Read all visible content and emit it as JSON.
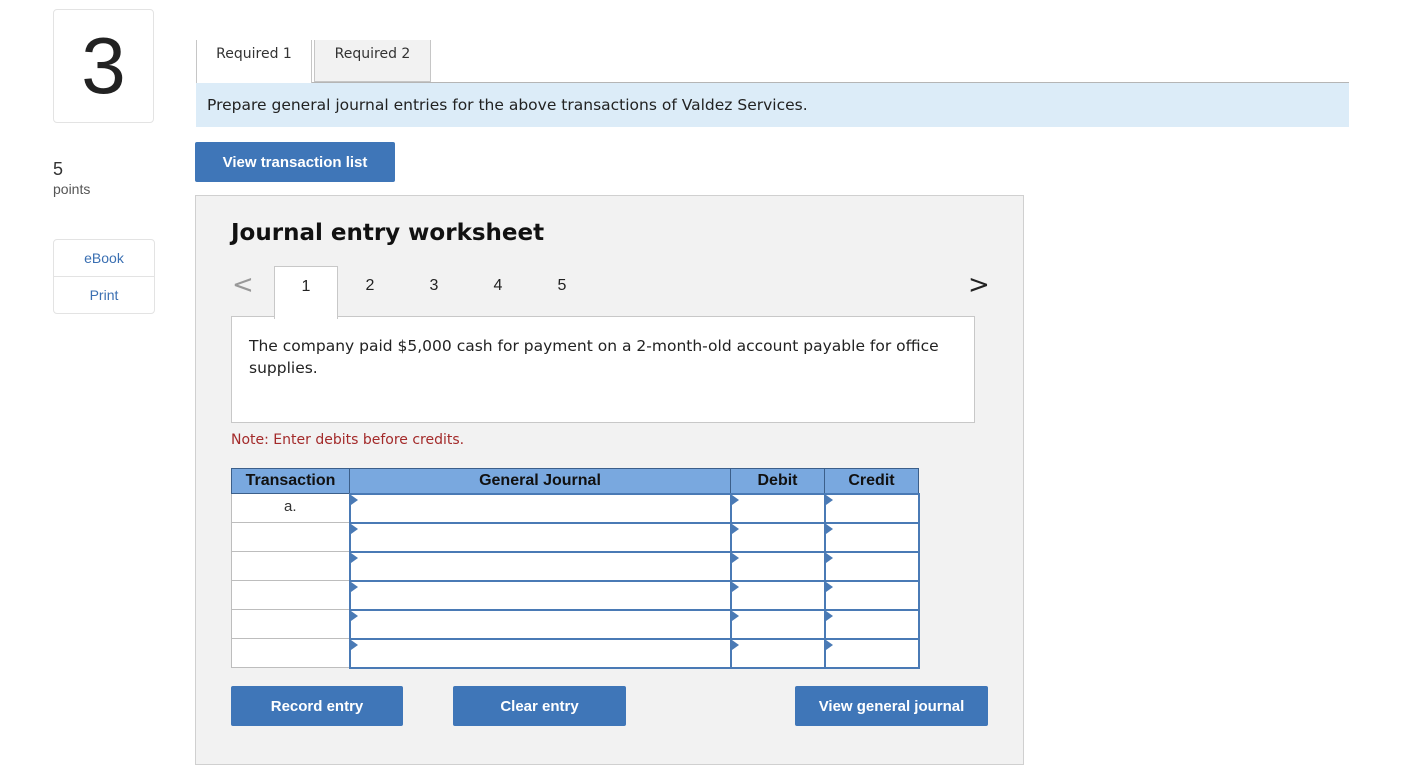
{
  "question": {
    "number": "3",
    "points_value": "5",
    "points_label": "points"
  },
  "side_links": {
    "ebook": "eBook",
    "print": "Print"
  },
  "tabs": {
    "required1": "Required 1",
    "required2": "Required 2"
  },
  "instruction": "Prepare general journal entries for the above transactions of Valdez Services.",
  "buttons": {
    "view_transaction_list": "View transaction list",
    "record_entry": "Record entry",
    "clear_entry": "Clear entry",
    "view_general_journal": "View general journal"
  },
  "worksheet": {
    "title": "Journal entry worksheet",
    "prev_arrow": "<",
    "next_arrow": ">",
    "pages": [
      "1",
      "2",
      "3",
      "4",
      "5"
    ],
    "active_page": "1",
    "description": "The company paid $5,000 cash for payment on a 2-month-old account payable for office supplies.",
    "note": "Note: Enter debits before credits."
  },
  "journal_table": {
    "headers": {
      "transaction": "Transaction",
      "general_journal": "General Journal",
      "debit": "Debit",
      "credit": "Credit"
    },
    "rows": [
      {
        "transaction": "a.",
        "account": "",
        "debit": "",
        "credit": ""
      },
      {
        "transaction": "",
        "account": "",
        "debit": "",
        "credit": ""
      },
      {
        "transaction": "",
        "account": "",
        "debit": "",
        "credit": ""
      },
      {
        "transaction": "",
        "account": "",
        "debit": "",
        "credit": ""
      },
      {
        "transaction": "",
        "account": "",
        "debit": "",
        "credit": ""
      },
      {
        "transaction": "",
        "account": "",
        "debit": "",
        "credit": ""
      }
    ]
  },
  "colors": {
    "accent_button": "#3f76b8",
    "instruction_bg": "#dcecf8",
    "table_header_bg": "#79a8df",
    "note_text": "#a32a2a"
  }
}
